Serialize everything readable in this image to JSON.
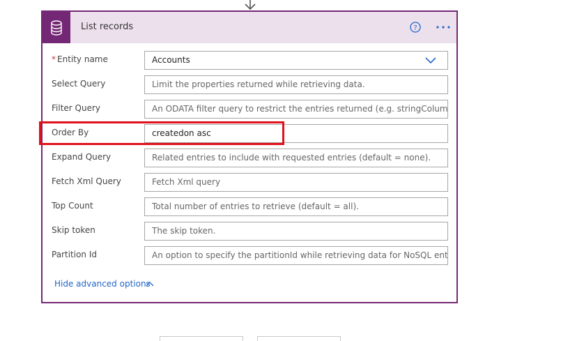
{
  "card": {
    "title": "List records",
    "accent_color": "#742774",
    "header_bg": "#ede0ed",
    "icon": "database-icon"
  },
  "fields": [
    {
      "label": "Entity name",
      "required": true,
      "value": "Accounts",
      "type": "dropdown"
    },
    {
      "label": "Select Query",
      "placeholder": "Limit the properties returned while retrieving data."
    },
    {
      "label": "Filter Query",
      "placeholder": "An ODATA filter query to restrict the entries returned (e.g. stringColumn eq 'stri"
    },
    {
      "label": "Order By",
      "value": "createdon asc"
    },
    {
      "label": "Expand Query",
      "placeholder": "Related entries to include with requested entries (default = none)."
    },
    {
      "label": "Fetch Xml Query",
      "placeholder": "Fetch Xml query"
    },
    {
      "label": "Top Count",
      "placeholder": "Total number of entries to retrieve (default = all)."
    },
    {
      "label": "Skip token",
      "placeholder": "The skip token."
    },
    {
      "label": "Partition Id",
      "placeholder": "An option to specify the partitionId while retrieving data for NoSQL entities."
    }
  ],
  "advanced_toggle": "Hide advanced options",
  "required_marker": "*",
  "highlight_color": "#e0111b"
}
